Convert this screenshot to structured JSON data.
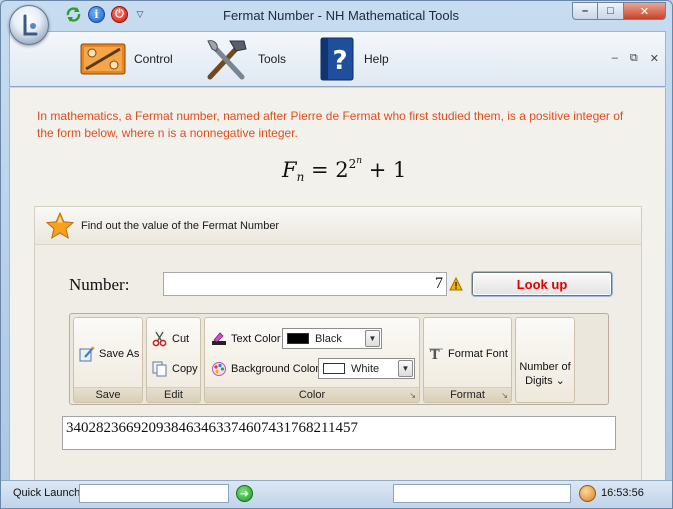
{
  "window": {
    "title": "Fermat Number - NH Mathematical Tools",
    "controls": {
      "minimize": "–",
      "maximize": "□",
      "close": "✕"
    }
  },
  "quick_access": {
    "icons": [
      "refresh-icon",
      "info-icon",
      "power-icon",
      "dropdown-arrow-icon"
    ],
    "info_glyph": "i",
    "power_glyph": "⏻",
    "dropdown_glyph": "▽"
  },
  "ribbon": {
    "tabs": [
      {
        "label": "Control",
        "icon": "control-panel-icon"
      },
      {
        "label": "Tools",
        "icon": "tools-icon"
      },
      {
        "label": "Help",
        "icon": "help-book-icon"
      }
    ],
    "mdi_controls": {
      "minimize": "–",
      "restore": "⧉",
      "close": "✕"
    }
  },
  "content": {
    "intro": "In mathematics, a Fermat number, named after Pierre de Fermat who first studied them, is a positive integer of the form below, where n is a nonnegative integer.",
    "formula": {
      "lhs": "F",
      "sub": "n",
      "eq": " = 2",
      "exp_base": "2",
      "exp_exp": "n",
      "tail": " + 1"
    }
  },
  "panel": {
    "title": "Find out the value of the Fermat Number",
    "number_label": "Number:",
    "number_value": "7",
    "lookup_label": "Look up",
    "toolbar": {
      "save": {
        "button": "Save As",
        "group": "Save"
      },
      "edit": {
        "cut": "Cut",
        "copy": "Copy",
        "group": "Edit"
      },
      "color": {
        "text_color_label": "Text Color",
        "text_color_value": "Black",
        "text_color_hex": "#000000",
        "background_color_label": "Background Color",
        "background_color_value": "White",
        "background_color_hex": "#ffffff",
        "group": "Color"
      },
      "format": {
        "button": "Format Font",
        "group": "Format"
      },
      "digits": {
        "line1": "Number of",
        "line2": "Digits",
        "arrow": "⌄"
      }
    },
    "result": "340282366920938463463374607431768211457"
  },
  "statusbar": {
    "quick_launch_label": "Quick Launch",
    "go_glyph": "➜",
    "time": "16:53:56"
  },
  "colors": {
    "intro_text": "#e04e1e",
    "lookup_text": "#e00000"
  }
}
